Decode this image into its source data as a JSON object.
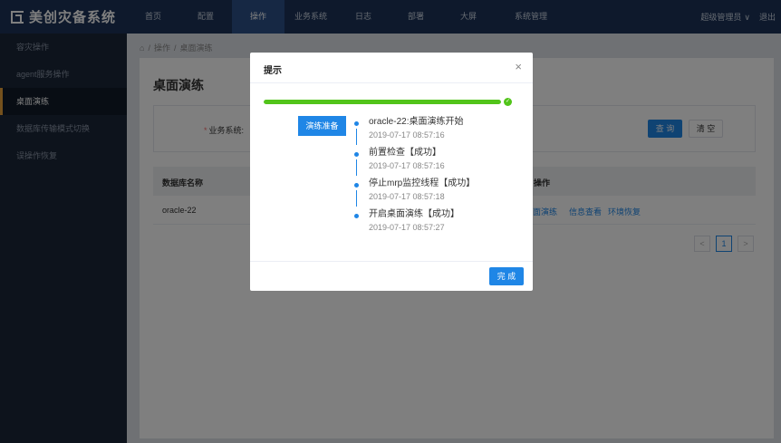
{
  "app": {
    "title": "美创灾备系统"
  },
  "nav": {
    "items": [
      "首页",
      "配置",
      "操作",
      "业务系统",
      "日志",
      "部署",
      "大屏",
      "系统管理"
    ],
    "user": "超级管理员",
    "logout": "退出"
  },
  "sidebar": {
    "items": [
      {
        "label": "容灾操作"
      },
      {
        "label": "agent服务操作"
      },
      {
        "label": "桌面演练"
      },
      {
        "label": "数据库传输模式切换"
      },
      {
        "label": "误操作恢复"
      }
    ]
  },
  "breadcrumb": {
    "items": [
      "操作",
      "桌面演练"
    ]
  },
  "page": {
    "title": "桌面演练",
    "filter_label": "业务系统:",
    "query_label": "查 询",
    "clear_label": "清 空"
  },
  "table": {
    "headers": [
      "数据库名称",
      "操作"
    ],
    "rows": [
      {
        "name": "oracle-22",
        "actions": [
          "桌面演练",
          "信息查看",
          "环境恢复"
        ]
      }
    ]
  },
  "pager": {
    "prev": "<",
    "current": "1",
    "next": ">"
  },
  "modal": {
    "title": "提示",
    "close": "×",
    "progress": 1.0,
    "progress_icon": "check-icon",
    "stage": "演练准备",
    "steps": [
      {
        "text": "oracle-22:桌面演练开始",
        "time": "2019-07-17 08:57:16"
      },
      {
        "text": "前置检查【成功】",
        "time": "2019-07-17 08:57:16"
      },
      {
        "text": "停止mrp监控线程【成功】",
        "time": "2019-07-17 08:57:18"
      },
      {
        "text": "开启桌面演练【成功】",
        "time": "2019-07-17 08:57:27"
      }
    ],
    "done_label": "完 成"
  },
  "colors": {
    "accent": "#1f86e6",
    "success": "#52c41a",
    "topbar": "#1c3358",
    "sidebar": "#1b2638"
  }
}
